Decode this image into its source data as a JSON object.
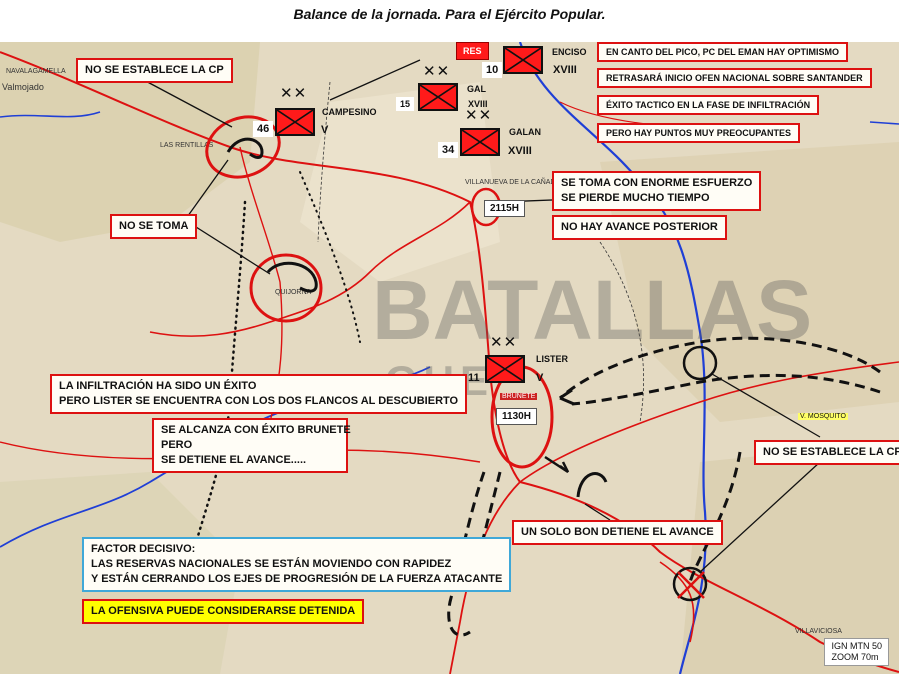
{
  "title": "Balance de la jornada. Para el Ejército Popular.",
  "watermark": {
    "line1": "BATALLAS",
    "line2": "GUE"
  },
  "colors": {
    "unit_fill": "#ff1a1a",
    "label_border": "#d11",
    "road": "#d11",
    "river": "#1f3fd6",
    "decisive_border": "#3fa8d8",
    "highlight": "#ffff00"
  },
  "callouts": {
    "cp_nw": "NO SE ESTABLECE LA CP",
    "no_se_toma": "NO SE TOMA",
    "optimism": "EN CANTO DEL PICO, PC DEL EMAN HAY OPTIMISMO",
    "delay": "RETRASARÁ INICIO OFEN NACIONAL SOBRE SANTANDER",
    "tactical": "ÉXITO TACTICO EN LA FASE DE INFILTRACIÓN",
    "worry": "PERO HAY PUNTOS MUY PREOCUPANTES",
    "se_toma_1": "SE TOMA CON ENORME ESFUERZO",
    "se_toma_2": "SE PIERDE MUCHO TIEMPO",
    "no_avance": "NO HAY AVANCE POSTERIOR",
    "infiltracion_1": "LA INFILTRACIÓN HA SIDO UN ÉXITO",
    "infiltracion_2": "PERO LISTER SE ENCUENTRA CON LOS DOS FLANCOS AL DESCUBIERTO",
    "brunete_1": "SE ALCANZA CON ÉXITO BRUNETE",
    "brunete_2": "PERO",
    "brunete_3": "SE DETIENE EL AVANCE.....",
    "cp_se": "NO SE ESTABLECE LA CP",
    "un_solo_bon": "UN SOLO BON DETIENE EL AVANCE",
    "factor_title": "FACTOR DECISIVO:",
    "factor_line1": "LAS RESERVAS NACIONALES SE ESTÁN MOVIENDO CON RAPIDEZ",
    "factor_line2": "Y ESTÁN CERRANDO LOS EJES DE PROGRESIÓN DE LA FUERZA ATACANTE",
    "detenida": "LA OFENSIVA PUEDE CONSIDERARSE DETENIDA"
  },
  "units": {
    "enciso": {
      "number": "10",
      "name": "ENCISO",
      "corps": "XVIII"
    },
    "gal": {
      "number": "15",
      "name": "GAL",
      "corps": "XVIII"
    },
    "galan": {
      "number": "34",
      "name": "GALAN",
      "corps": "XVIII"
    },
    "campesino": {
      "number": "46",
      "name": "CAMPESINO",
      "corps": "V"
    },
    "lister": {
      "number": "11",
      "name": "LISTER",
      "corps": "V"
    },
    "division_marker": "✕✕",
    "reserve": "RES"
  },
  "times": {
    "villanueva": "2115H",
    "brunete": "1130H"
  },
  "places": {
    "navalagamella": "NAVALAGAMELLA",
    "valmojado": "Valmojado",
    "rentillas": "LAS RENTILLAS",
    "villanueva_canada": "VILLANUEVA DE LA CAÑADA",
    "brunete": "BRUNETE",
    "mosquito": "V. MOSQUITO",
    "villaviciosa": "VILLAVICIOSA",
    "quijorna": "QUIJORNA"
  },
  "map_source": {
    "line1": "IGN MTN 50",
    "line2": "ZOOM 70m"
  }
}
